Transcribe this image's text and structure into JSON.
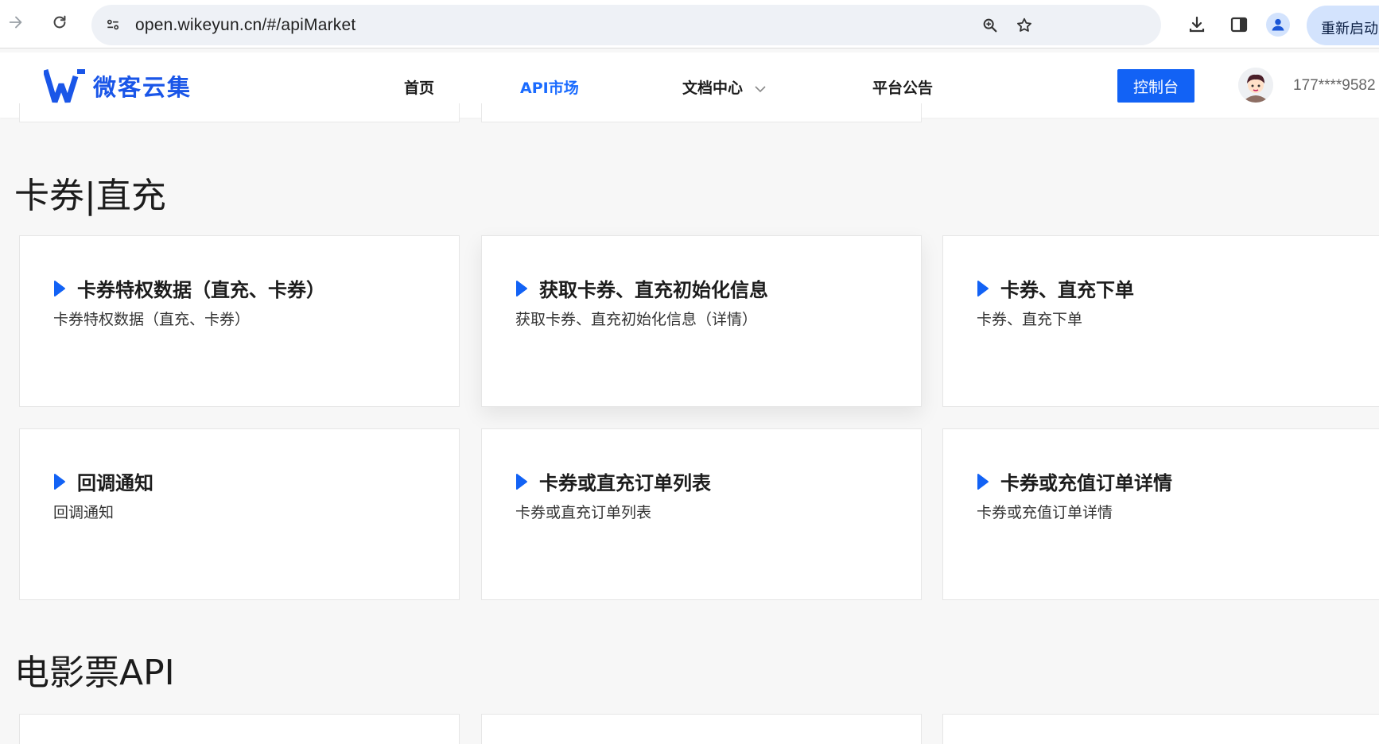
{
  "browser": {
    "url": "open.wikeyun.cn/#/apiMarket",
    "restart_label": "重新启动"
  },
  "site": {
    "logo_text": "微客云集",
    "nav": [
      {
        "label": "首页"
      },
      {
        "label": "API市场"
      },
      {
        "label": "文档中心"
      },
      {
        "label": "平台公告"
      }
    ],
    "console_label": "控制台",
    "user_phone": "177****9582"
  },
  "colors": {
    "brand": "#1a56e8",
    "nav_active": "#1a6bff",
    "console_button": "#1262f5",
    "page_background": "#f7f7f7"
  },
  "sections": [
    {
      "title": "卡券|直充",
      "cards": [
        {
          "title": "卡券特权数据（直充、卡券）",
          "desc": "卡券特权数据（直充、卡券）"
        },
        {
          "title": "获取卡券、直充初始化信息",
          "desc": "获取卡券、直充初始化信息（详情）"
        },
        {
          "title": "卡券、直充下单",
          "desc": "卡券、直充下单"
        },
        {
          "title": "回调通知",
          "desc": "回调通知"
        },
        {
          "title": "卡券或直充订单列表",
          "desc": "卡券或直充订单列表"
        },
        {
          "title": "卡券或充值订单详情",
          "desc": "卡券或充值订单详情"
        }
      ]
    },
    {
      "title": "电影票API"
    }
  ]
}
